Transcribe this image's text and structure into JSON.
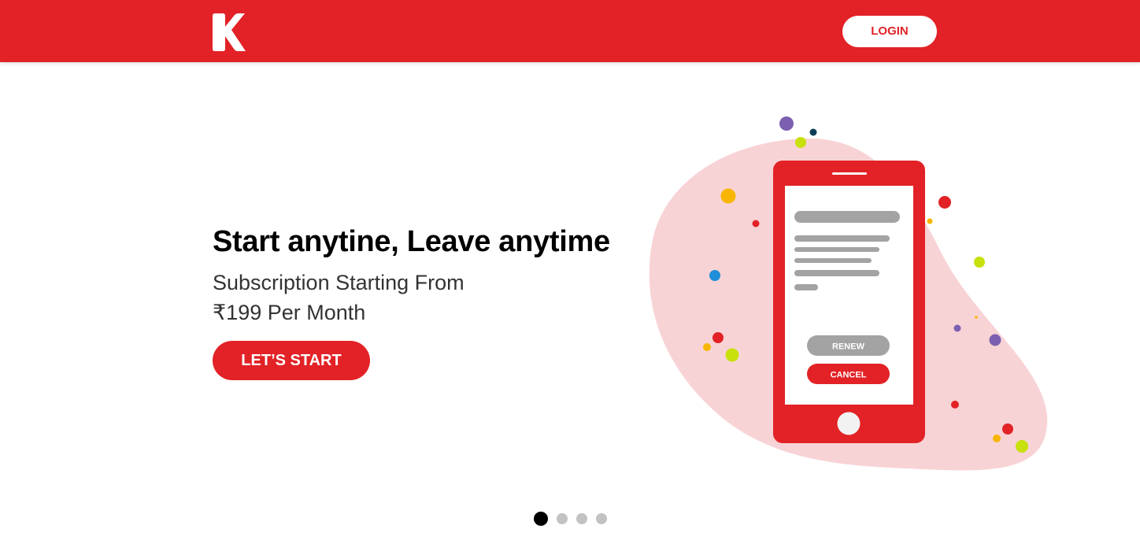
{
  "header": {
    "logo_letter": "K",
    "login_label": "LOGIN"
  },
  "hero": {
    "title": "Start anytine, Leave anytime",
    "subtitle_line1": "Subscription Starting From",
    "subtitle_line2": "₹199 Per Month",
    "cta_label": "LET’S START"
  },
  "phone": {
    "renew_label": "RENEW",
    "cancel_label": "CANCEL"
  },
  "carousel": {
    "slide_count": 4,
    "active_index": 0
  },
  "colors": {
    "brand_red": "#e22226",
    "blob_pink": "#f8d3d5",
    "placeholder_gray": "#a3a3a3",
    "white": "#ffffff",
    "black": "#000000"
  },
  "icons": {
    "logo": "k-logo-icon",
    "illustration": "phone-subscription-illustration"
  }
}
